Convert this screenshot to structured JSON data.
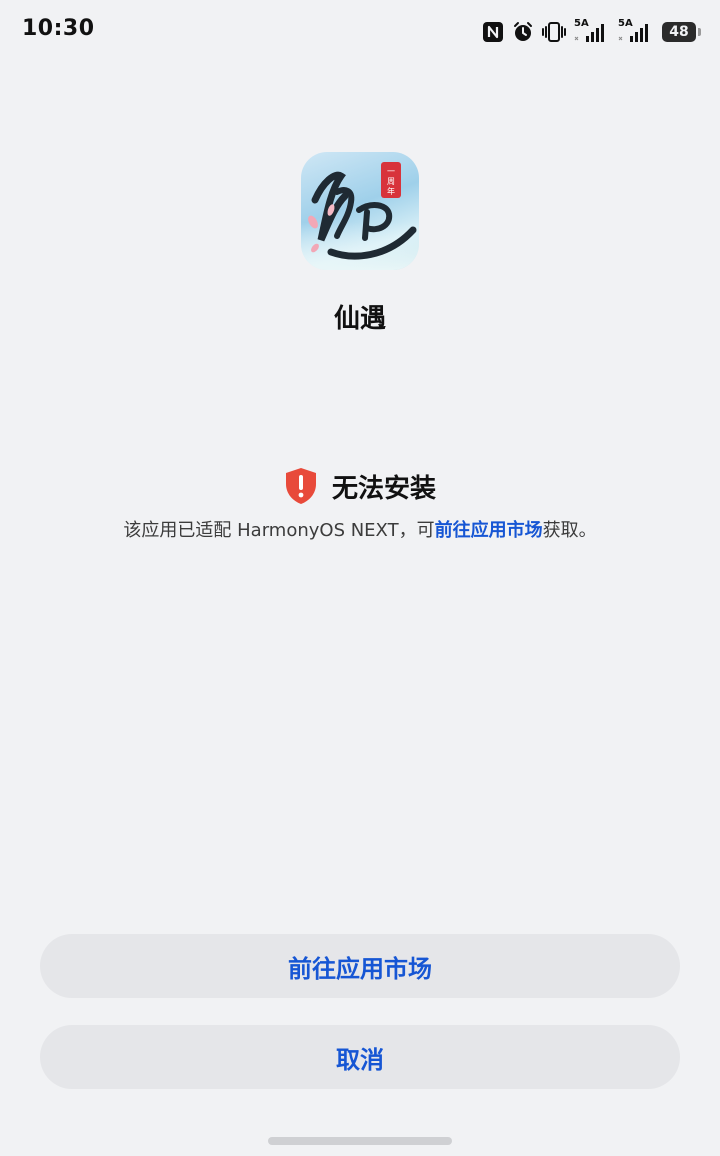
{
  "status_bar": {
    "time": "10:30",
    "signal1_tag": "5A",
    "signal2_tag": "5A",
    "battery": "48",
    "icons": [
      "nfc-icon",
      "alarm-icon",
      "vibrate-icon",
      "signal-icon",
      "signal-icon",
      "battery-icon"
    ]
  },
  "app": {
    "name": "仙遇",
    "icon_badge": "一周年"
  },
  "error": {
    "title": "无法安装",
    "desc_prefix": "该应用已适配 HarmonyOS NEXT，可",
    "desc_link": "前往应用市场",
    "desc_suffix": "获取。",
    "icon_color": "#e84a3a"
  },
  "buttons": {
    "market": "前往应用市场",
    "cancel": "取消"
  },
  "colors": {
    "accent": "#1656d4",
    "background": "#f1f2f4",
    "button_bg": "#e5e6e9"
  }
}
